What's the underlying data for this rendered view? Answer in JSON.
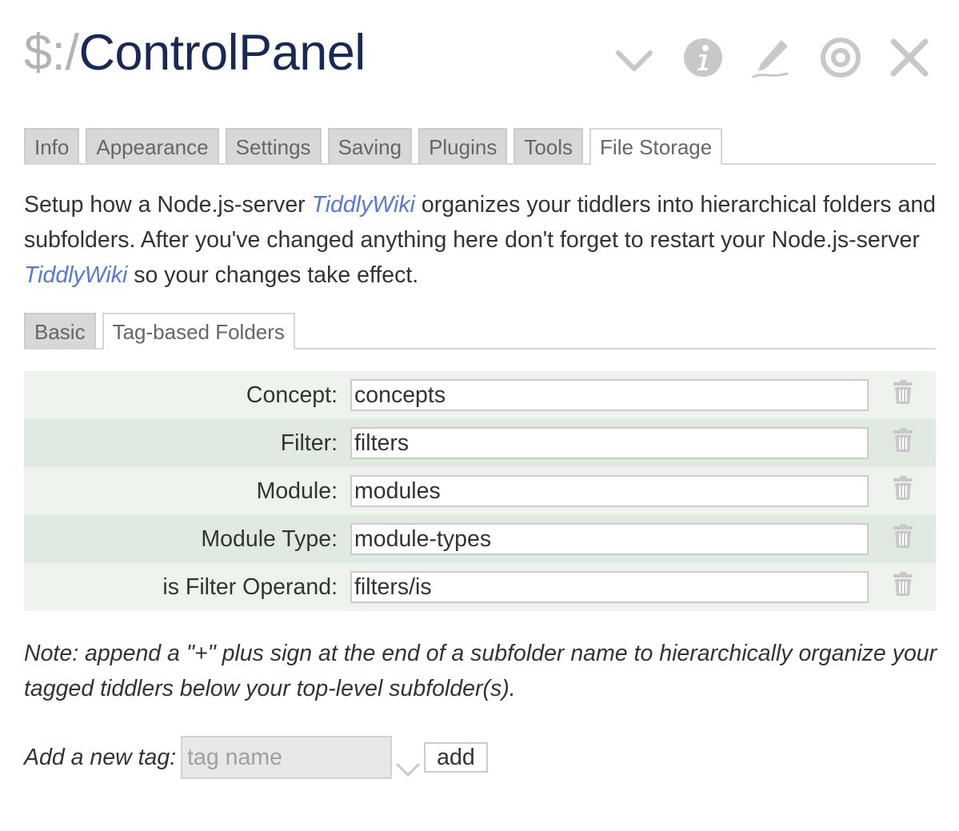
{
  "title": {
    "prefix": "$:/",
    "name": "ControlPanel"
  },
  "toolbar": [
    {
      "icon": "chevron-down-icon"
    },
    {
      "icon": "info-icon"
    },
    {
      "icon": "edit-icon"
    },
    {
      "icon": "target-icon"
    },
    {
      "icon": "close-icon"
    }
  ],
  "main_tabs": [
    "Info",
    "Appearance",
    "Settings",
    "Saving",
    "Plugins",
    "Tools",
    "File Storage"
  ],
  "main_tabs_active": "File Storage",
  "description": {
    "part1": "Setup how a Node.js-server ",
    "link1": "TiddlyWiki",
    "part2": " organizes your tiddlers into hierarchical folders and subfolders. After you've changed anything here don't forget to restart your Node.js-server ",
    "link2": "TiddlyWiki",
    "part3": " so your changes take effect."
  },
  "sub_tabs": [
    "Basic",
    "Tag-based Folders"
  ],
  "sub_tabs_active": "Tag-based Folders",
  "tag_rows": [
    {
      "label": "Concept:",
      "value": "concepts"
    },
    {
      "label": "Filter:",
      "value": "filters"
    },
    {
      "label": "Module:",
      "value": "modules"
    },
    {
      "label": "Module Type:",
      "value": "module-types"
    },
    {
      "label": "is Filter Operand:",
      "value": "filters/is"
    }
  ],
  "delete_icon": "trash-icon",
  "note": "Note: append a \"+\" plus sign at the end of a subfolder name to hierarchically organize your tagged tiddlers below your top-level subfolder(s).",
  "add_tag": {
    "label": "Add a new tag:",
    "placeholder": "tag name",
    "value": "",
    "button": "add"
  },
  "colors": {
    "title": "#182955",
    "prefix": "#b3b3b3",
    "link": "#5778d8",
    "row_light": "#eef3ee",
    "row_dark": "#e1eae1",
    "icon": "#c8c8c8"
  }
}
